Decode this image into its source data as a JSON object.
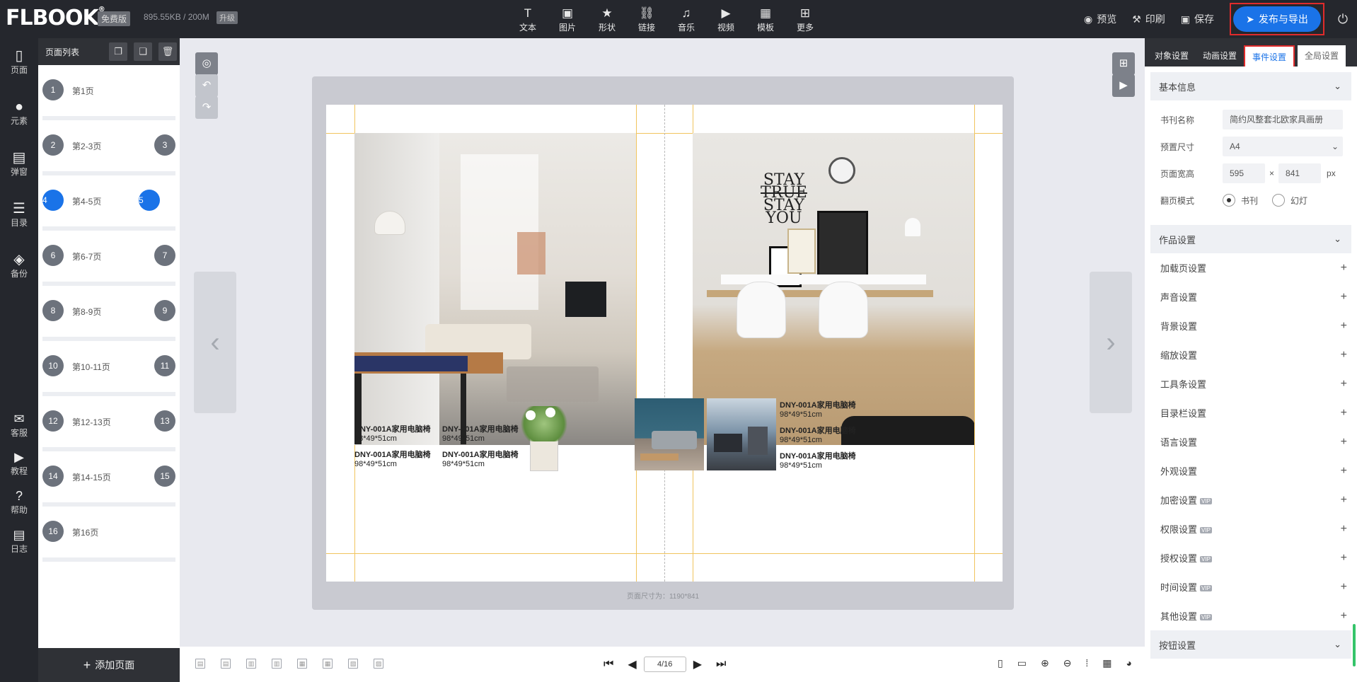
{
  "topbar": {
    "logo": "FLBOOK",
    "free": "免费版",
    "storage": "895.55KB / 200M",
    "upgrade": "升级",
    "tools": [
      {
        "icon": "text-icon",
        "glyph": "T",
        "label": "文本"
      },
      {
        "icon": "image-icon",
        "glyph": "▣",
        "label": "图片"
      },
      {
        "icon": "shape-icon",
        "glyph": "★",
        "label": "形状"
      },
      {
        "icon": "link-icon",
        "glyph": "⛓",
        "label": "链接"
      },
      {
        "icon": "music-icon",
        "glyph": "♫",
        "label": "音乐"
      },
      {
        "icon": "video-icon",
        "glyph": "▶",
        "label": "视频"
      },
      {
        "icon": "template-icon",
        "glyph": "▦",
        "label": "模板"
      },
      {
        "icon": "more-icon",
        "glyph": "⊞",
        "label": "更多"
      }
    ],
    "preview": "预览",
    "print": "印刷",
    "save": "保存",
    "publish": "发布与导出"
  },
  "leftnav": {
    "items": [
      {
        "label": "页面",
        "glyph": "▯"
      },
      {
        "label": "元素",
        "glyph": "●"
      },
      {
        "label": "弹窗",
        "glyph": "▤"
      },
      {
        "label": "目录",
        "glyph": "☰"
      },
      {
        "label": "备份",
        "glyph": "◈"
      }
    ],
    "bottom": [
      {
        "label": "客服",
        "glyph": "✉"
      },
      {
        "label": "教程",
        "glyph": "▶"
      },
      {
        "label": "帮助",
        "glyph": "?"
      },
      {
        "label": "日志",
        "glyph": "▤"
      }
    ]
  },
  "pagepanel": {
    "title": "页面列表",
    "add": "添加页面",
    "pages": [
      {
        "n": "1",
        "label": "第1页",
        "r": ""
      },
      {
        "n": "2",
        "label": "第2-3页",
        "r": "3"
      },
      {
        "n": "4",
        "label": "第4-5页",
        "r": "5",
        "active": true
      },
      {
        "n": "6",
        "label": "第6-7页",
        "r": "7"
      },
      {
        "n": "8",
        "label": "第8-9页",
        "r": "9"
      },
      {
        "n": "10",
        "label": "第10-11页",
        "r": "11"
      },
      {
        "n": "12",
        "label": "第12-13页",
        "r": "13"
      },
      {
        "n": "14",
        "label": "第14-15页",
        "r": "15"
      },
      {
        "n": "16",
        "label": "第16页",
        "r": ""
      }
    ]
  },
  "canvas": {
    "size_caption": "页面尺寸为：1190*841",
    "poster_text": [
      "STAY",
      "TRUE",
      "STAY",
      "YOU"
    ],
    "products_left": [
      {
        "name": "DNY-001A家用电脑椅",
        "size": "98*49*51cm"
      },
      {
        "name": "DNY-001A家用电脑椅",
        "size": "98*49*51cm"
      },
      {
        "name": "DNY-001A家用电脑椅",
        "size": "98*49*51cm"
      },
      {
        "name": "DNY-001A家用电脑椅",
        "size": "98*49*51cm"
      }
    ],
    "products_right": [
      {
        "name": "DNY-001A家用电脑椅",
        "size": "98*49*51cm"
      },
      {
        "name": "DNY-001A家用电脑椅",
        "size": "98*49*51cm"
      },
      {
        "name": "DNY-001A家用电脑椅",
        "size": "98*49*51cm"
      }
    ]
  },
  "pager": {
    "value": "4/16"
  },
  "rpanel": {
    "tabs": [
      "对象设置",
      "动画设置",
      "事件设置",
      "全局设置"
    ],
    "basic": "基本信息",
    "name_label": "书刊名称",
    "name_value": "简约风整套北欧家具画册",
    "preset_label": "预置尺寸",
    "preset_value": "A4",
    "size_label": "页面宽高",
    "width": "595",
    "x": "×",
    "height": "841",
    "unit": "px",
    "flip_label": "翻页模式",
    "flip_book": "书刊",
    "flip_slide": "幻灯",
    "works": "作品设置",
    "settings": [
      {
        "label": "加载页设置",
        "vip": ""
      },
      {
        "label": "声音设置",
        "vip": ""
      },
      {
        "label": "背景设置",
        "vip": ""
      },
      {
        "label": "缩放设置",
        "vip": ""
      },
      {
        "label": "工具条设置",
        "vip": ""
      },
      {
        "label": "目录栏设置",
        "vip": ""
      },
      {
        "label": "语言设置",
        "vip": ""
      },
      {
        "label": "外观设置",
        "vip": ""
      },
      {
        "label": "加密设置",
        "vip": "VIP"
      },
      {
        "label": "权限设置",
        "vip": "VIP"
      },
      {
        "label": "授权设置",
        "vip": "VIP"
      },
      {
        "label": "时间设置",
        "vip": "VIP"
      },
      {
        "label": "其他设置",
        "vip": "VIP"
      }
    ],
    "button": "按钮设置"
  }
}
